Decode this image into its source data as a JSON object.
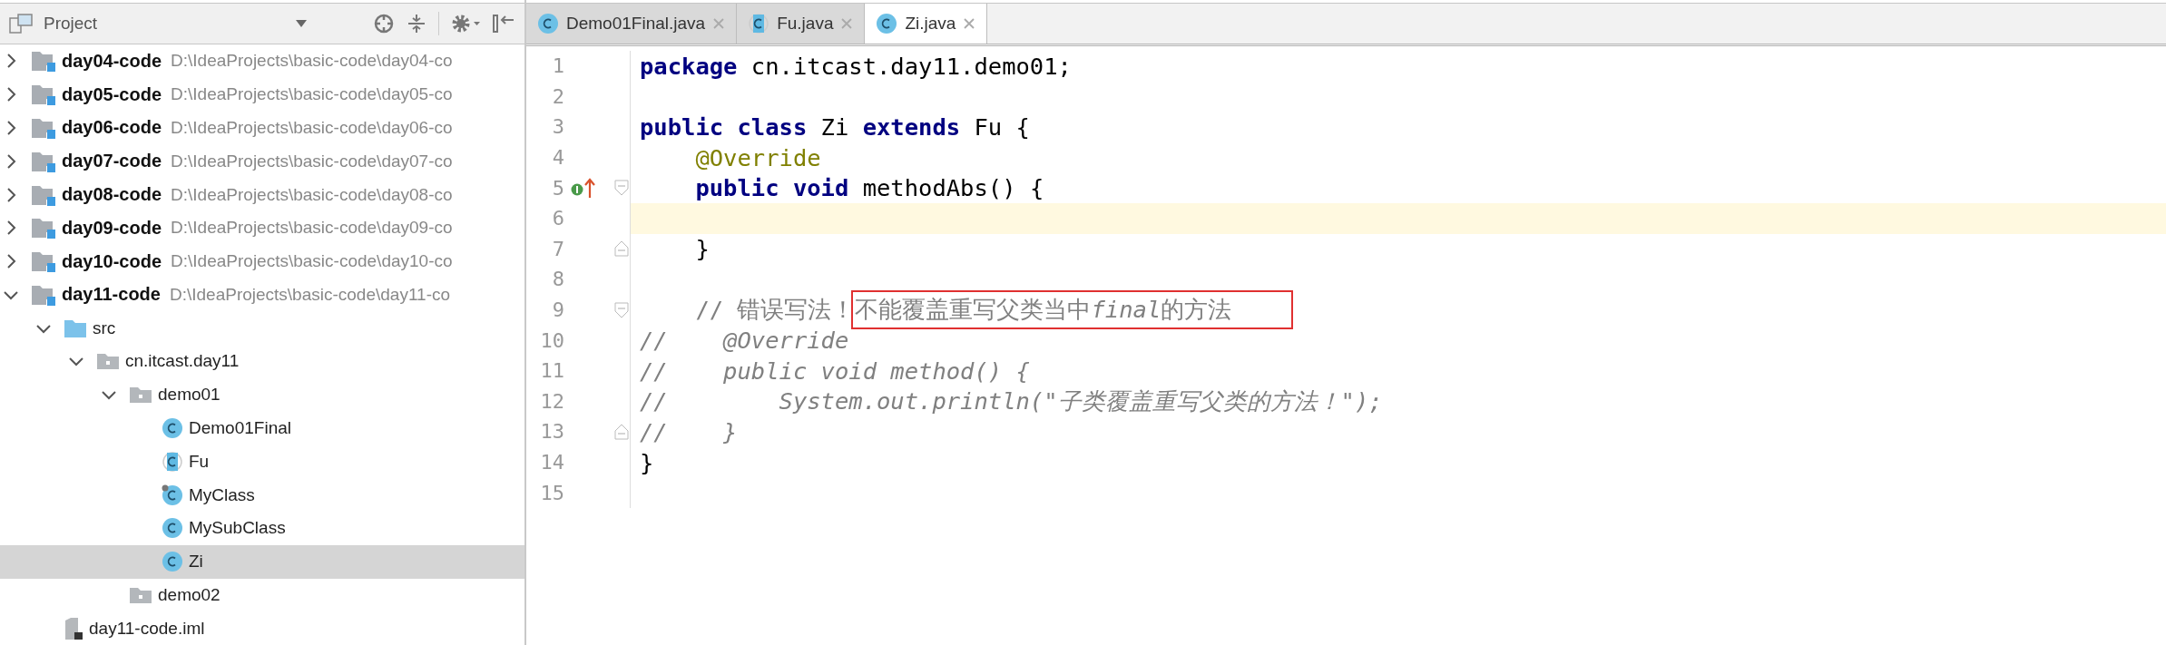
{
  "sidebar": {
    "title": "Project",
    "tree": [
      {
        "kind": "module",
        "name": "day04-code",
        "path": "D:\\IdeaProjects\\basic-code\\day04-co",
        "expanded": false,
        "selected": false
      },
      {
        "kind": "module",
        "name": "day05-code",
        "path": "D:\\IdeaProjects\\basic-code\\day05-co",
        "expanded": false,
        "selected": false
      },
      {
        "kind": "module",
        "name": "day06-code",
        "path": "D:\\IdeaProjects\\basic-code\\day06-co",
        "expanded": false,
        "selected": false
      },
      {
        "kind": "module",
        "name": "day07-code",
        "path": "D:\\IdeaProjects\\basic-code\\day07-co",
        "expanded": false,
        "selected": false
      },
      {
        "kind": "module",
        "name": "day08-code",
        "path": "D:\\IdeaProjects\\basic-code\\day08-co",
        "expanded": false,
        "selected": false
      },
      {
        "kind": "module",
        "name": "day09-code",
        "path": "D:\\IdeaProjects\\basic-code\\day09-co",
        "expanded": false,
        "selected": false
      },
      {
        "kind": "module",
        "name": "day10-code",
        "path": "D:\\IdeaProjects\\basic-code\\day10-co",
        "expanded": false,
        "selected": false
      },
      {
        "kind": "module",
        "name": "day11-code",
        "path": "D:\\IdeaProjects\\basic-code\\day11-co",
        "expanded": true,
        "selected": false,
        "children": [
          {
            "kind": "source-folder",
            "name": "src",
            "expanded": true,
            "selected": false,
            "children": [
              {
                "kind": "package",
                "name": "cn.itcast.day11",
                "expanded": true,
                "selected": false,
                "children": [
                  {
                    "kind": "package",
                    "name": "demo01",
                    "expanded": true,
                    "selected": false,
                    "children": [
                      {
                        "kind": "class",
                        "name": "Demo01Final",
                        "selected": false
                      },
                      {
                        "kind": "abstract-class",
                        "name": "Fu",
                        "selected": false
                      },
                      {
                        "kind": "marked-class",
                        "name": "MyClass",
                        "selected": false
                      },
                      {
                        "kind": "class",
                        "name": "MySubClass",
                        "selected": false
                      },
                      {
                        "kind": "class",
                        "name": "Zi",
                        "selected": true
                      }
                    ]
                  },
                  {
                    "kind": "package",
                    "name": "demo02",
                    "selected": false
                  }
                ]
              }
            ]
          },
          {
            "kind": "file",
            "name": "day11-code.iml",
            "selected": false
          }
        ]
      }
    ]
  },
  "tabs": [
    {
      "kind": "class",
      "label": "Demo01Final.java",
      "selected": false
    },
    {
      "kind": "abstract-class",
      "label": "Fu.java",
      "selected": false
    },
    {
      "kind": "class",
      "label": "Zi.java",
      "selected": true
    }
  ],
  "editor": {
    "lines": [
      {
        "number": "1",
        "current": false,
        "tokens": [
          {
            "kind": "keyword",
            "text": "package"
          },
          {
            "kind": "plain",
            "text": " cn.itcast.day11.demo01;"
          }
        ]
      },
      {
        "number": "2",
        "current": false
      },
      {
        "number": "3",
        "current": false,
        "tokens": [
          {
            "kind": "keyword",
            "text": "public class"
          },
          {
            "kind": "plain",
            "text": " Zi "
          },
          {
            "kind": "keyword",
            "text": "extends"
          },
          {
            "kind": "plain",
            "text": " Fu {"
          }
        ]
      },
      {
        "number": "4",
        "current": false,
        "tokens": [
          {
            "kind": "annotation",
            "text": "    @Override"
          }
        ]
      },
      {
        "number": "5",
        "current": false,
        "override_marker": true,
        "fold_start": true,
        "tokens": [
          {
            "kind": "keyword",
            "text": "    public void"
          },
          {
            "kind": "plain",
            "text": " methodAbs() {"
          }
        ]
      },
      {
        "number": "6",
        "current": true
      },
      {
        "number": "7",
        "current": false,
        "fold_end": true,
        "tokens": [
          {
            "kind": "plain",
            "text": "    }"
          }
        ]
      },
      {
        "number": "8",
        "current": false
      },
      {
        "number": "9",
        "current": false,
        "fold_start": true,
        "tokens": [
          {
            "kind": "comment",
            "text": "    // 错误写法！"
          },
          {
            "kind": "boxed",
            "parts": [
              {
                "text": "不能覆盖重写父类当中",
                "italic": false
              },
              {
                "text": "final",
                "italic": true
              },
              {
                "text": "的方法",
                "italic": false
              }
            ]
          }
        ]
      },
      {
        "number": "10",
        "current": false,
        "tokens": [
          {
            "kind": "italic-comment",
            "text": "//    @Override"
          }
        ]
      },
      {
        "number": "11",
        "current": false,
        "tokens": [
          {
            "kind": "italic-comment",
            "text": "//    public void method() {"
          }
        ]
      },
      {
        "number": "12",
        "current": false,
        "tokens": [
          {
            "kind": "italic-comment",
            "text": "//        System.out.println(\"子类覆盖重写父类的方法！\");"
          }
        ]
      },
      {
        "number": "13",
        "current": false,
        "fold_end": true,
        "tokens": [
          {
            "kind": "italic-comment",
            "text": "//    }"
          }
        ]
      },
      {
        "number": "14",
        "current": false,
        "tokens": [
          {
            "kind": "plain",
            "text": "}"
          }
        ]
      },
      {
        "number": "15",
        "current": false
      }
    ]
  }
}
